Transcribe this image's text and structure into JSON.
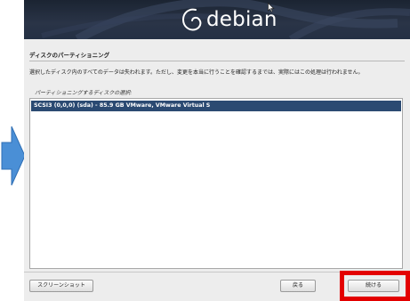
{
  "banner": {
    "logo_text": "debian"
  },
  "page": {
    "title": "ディスクのパーティショニング",
    "description": "選択したディスク内のすべてのデータは失われます。ただし、変更を本当に行うことを確認するまでは、実際にはこの処理は行われません。",
    "list_label": "パーティショニングするディスクの選択:"
  },
  "disks": [
    {
      "label": "SCSI3 (0,0,0) (sda) - 85.9 GB VMware, VMware Virtual S",
      "selected": true
    }
  ],
  "buttons": {
    "screenshot": "スクリーンショット",
    "back": "戻る",
    "continue": "続ける"
  },
  "colors": {
    "banner": "#243044",
    "selection": "#2b4a72",
    "highlight": "#e30000",
    "arrow": "#4a8fd6"
  },
  "icons": [
    "right-arrow-icon",
    "debian-swirl-icon",
    "mouse-cursor-icon"
  ]
}
